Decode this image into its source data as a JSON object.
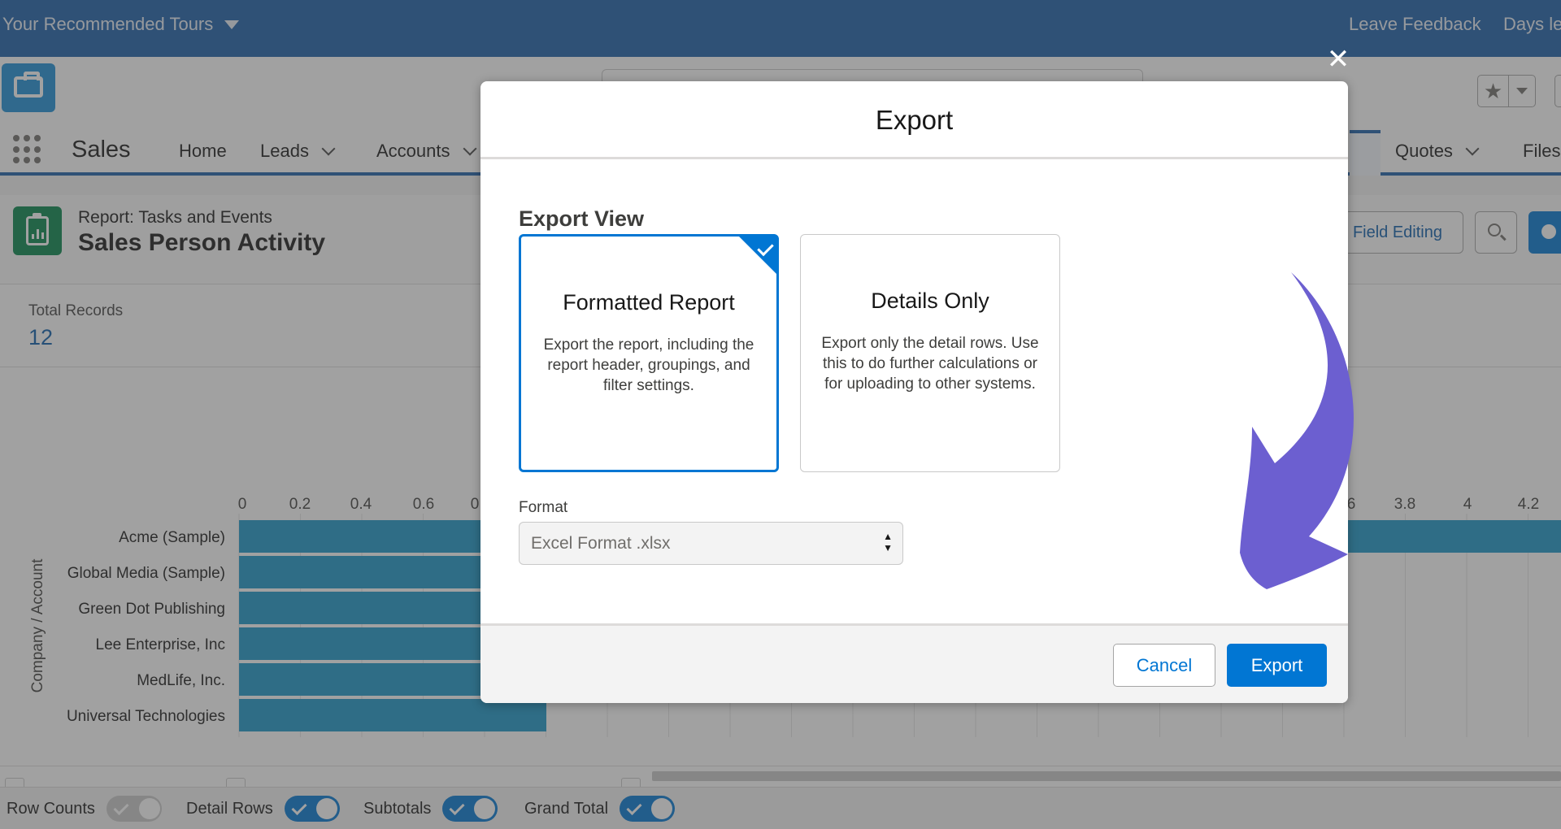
{
  "topbar": {
    "tours_label": "Your Recommended Tours",
    "feedback_label": "Leave Feedback",
    "days_label": "Days le"
  },
  "nav": {
    "app_name": "Sales",
    "items": [
      {
        "label": "Home",
        "has_menu": false
      },
      {
        "label": "Leads",
        "has_menu": true
      },
      {
        "label": "Accounts",
        "has_menu": true
      },
      {
        "label": "Quotes",
        "has_menu": true
      },
      {
        "label": "Files",
        "has_menu": false
      }
    ]
  },
  "report": {
    "kicker": "Report: Tasks and Events",
    "title": "Sales Person Activity",
    "field_editing_label": "Field Editing",
    "total_records_label": "Total Records",
    "total_records_value": "12"
  },
  "chart_data": {
    "type": "bar",
    "orientation": "horizontal",
    "ylabel": "Company / Account",
    "categories": [
      "Acme (Sample)",
      "Global Media (Sample)",
      "Green Dot Publishing",
      "Lee Enterprise, Inc",
      "MedLife, Inc.",
      "Universal Technologies"
    ],
    "x_ticks": [
      "0",
      "0.2",
      "0.4",
      "0.6",
      "0",
      "6",
      "3.8",
      "4",
      "4.2"
    ],
    "values": [
      4.4,
      2,
      2,
      2,
      2,
      1
    ],
    "bar_color": "#1b96c8"
  },
  "footer": {
    "toggles": [
      {
        "label": "Row Counts",
        "on": false
      },
      {
        "label": "Detail Rows",
        "on": true
      },
      {
        "label": "Subtotals",
        "on": true
      },
      {
        "label": "Grand Total",
        "on": true
      }
    ]
  },
  "modal": {
    "title": "Export",
    "section_title": "Export View",
    "options": [
      {
        "title": "Formatted Report",
        "description": "Export the report, including the report header, groupings, and filter settings.",
        "selected": true
      },
      {
        "title": "Details Only",
        "description": "Export only the detail rows. Use this to do further calculations or for uploading to other systems.",
        "selected": false
      }
    ],
    "format_label": "Format",
    "format_value": "Excel Format .xlsx",
    "cancel_label": "Cancel",
    "export_label": "Export",
    "close_icon": "✕"
  },
  "colors": {
    "brand_blue": "#0176d3",
    "banner_blue": "#1b5fa8",
    "arrow_purple": "#6c5fd0"
  }
}
